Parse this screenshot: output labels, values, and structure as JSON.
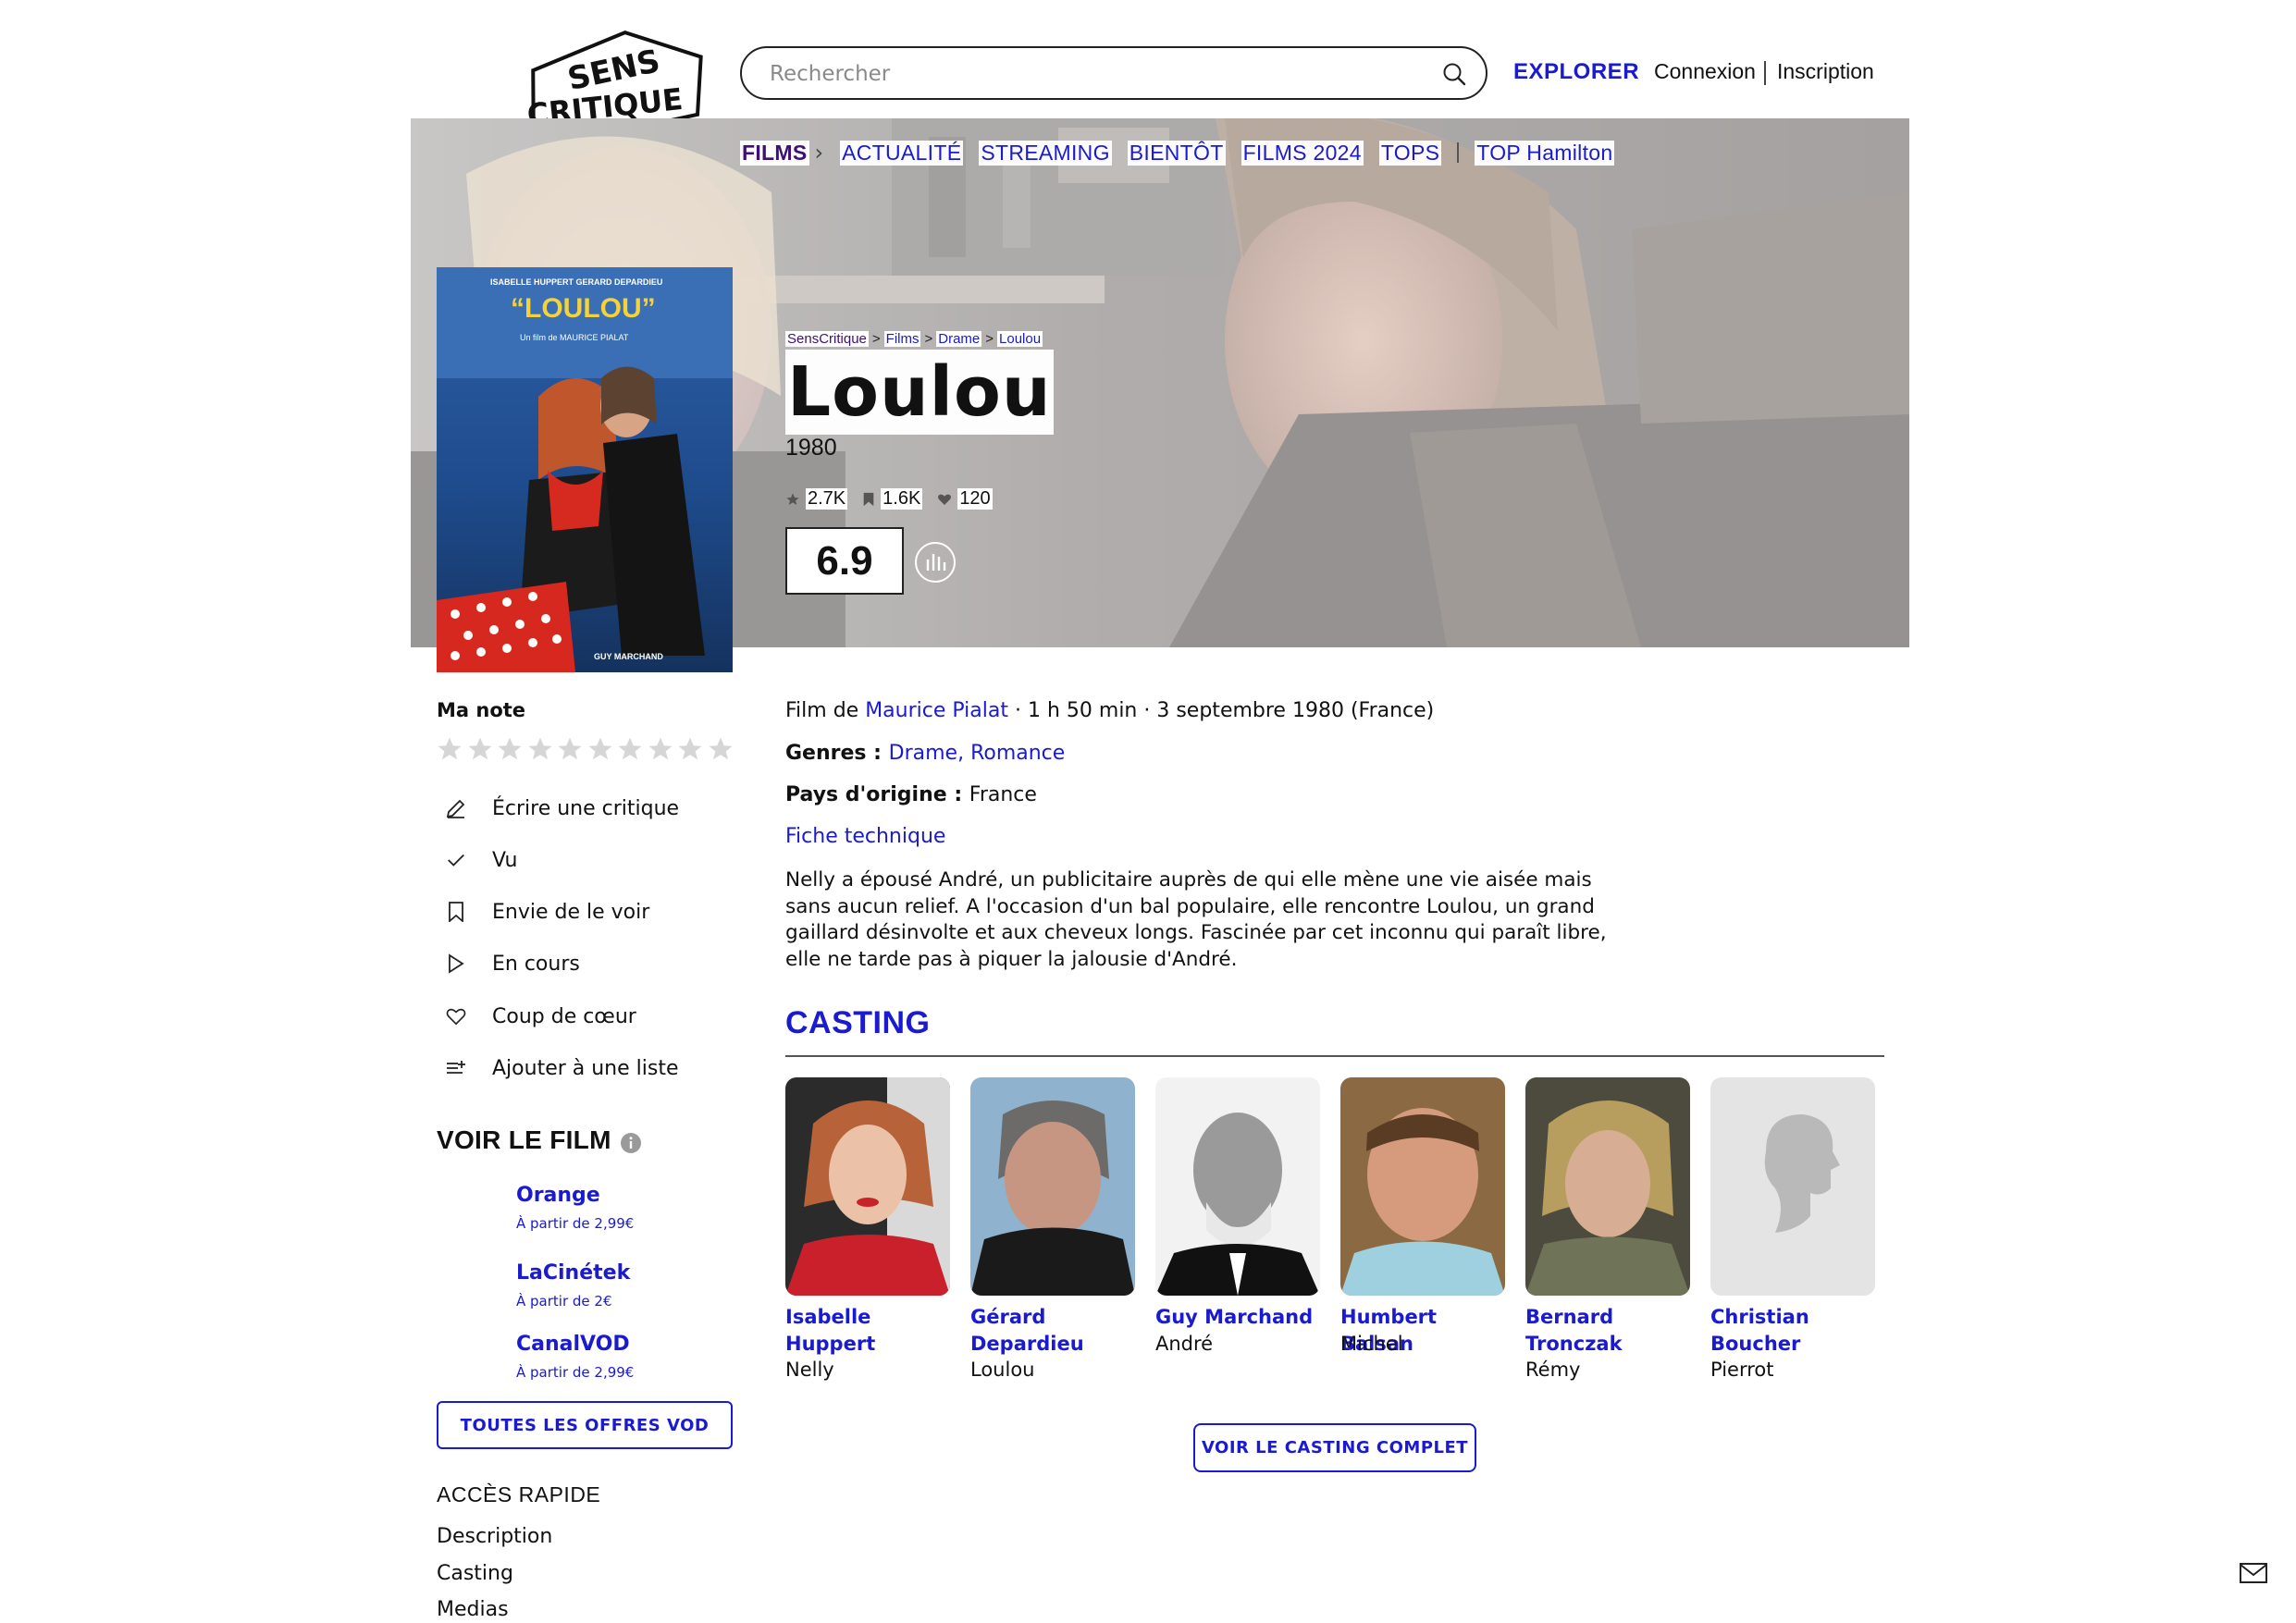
{
  "header": {
    "logo_line1": "SENS",
    "logo_line2": "CRITIQUE",
    "search_placeholder": "Rechercher",
    "explore_label": "EXPLORER",
    "login_label": "Connexion",
    "signup_label": "Inscription"
  },
  "nav": {
    "items": [
      "FILMS",
      "ACTUALITÉ",
      "STREAMING",
      "BIENTÔT",
      "FILMS 2024",
      "TOPS",
      "TOP Hamilton"
    ]
  },
  "poster": {
    "actors_line": "ISABELLE HUPPERT    GERARD DEPARDIEU",
    "title": "“LOULOU”",
    "director_line": "Un film de MAURICE PIALAT",
    "bottom_credit": "GUY MARCHAND"
  },
  "breadcrumb": [
    "SensCritique",
    "Films",
    "Drame",
    "Loulou"
  ],
  "breadcrumb_sep": ">",
  "movie": {
    "title": "Loulou",
    "year": "1980",
    "stats": {
      "ratings": "2.7K",
      "wishlist": "1.6K",
      "favorites": "120"
    },
    "score": "6.9",
    "director_prefix": "Film de ",
    "director": "Maurice Pialat",
    "meta_suffix": " · 1 h 50 min · 3 septembre 1980 (France)",
    "genres_label": "Genres : ",
    "genres": [
      "Drame",
      "Romance"
    ],
    "genre_sep": ", ",
    "country_label": "Pays d'origine : ",
    "country": "France",
    "tech_link": "Fiche technique",
    "synopsis": "Nelly a épousé André, un publicitaire auprès de qui elle mène une vie aisée mais sans aucun relief. A l'occasion d'un bal populaire, elle rencontre Loulou, un grand gaillard désinvolte et aux cheveux longs. Fascinée par cet inconnu qui paraît libre, elle ne tarde pas à piquer la jalousie d'André."
  },
  "user_rating": {
    "label": "Ma note",
    "max_stars": 10
  },
  "actions": [
    {
      "label": "Écrire une critique",
      "icon": "pencil-icon"
    },
    {
      "label": "Vu",
      "icon": "check-icon"
    },
    {
      "label": "Envie de le voir",
      "icon": "bookmark-icon"
    },
    {
      "label": "En cours",
      "icon": "play-icon"
    },
    {
      "label": "Coup de cœur",
      "icon": "heart-icon"
    },
    {
      "label": "Ajouter à une liste",
      "icon": "list-add-icon"
    }
  ],
  "watch": {
    "title": "VOIR LE FILM",
    "offers": [
      {
        "name": "Orange",
        "price": "À partir de 2,99€"
      },
      {
        "name": "LaCinétek",
        "price": "À partir de 2€"
      },
      {
        "name": "CanalVOD",
        "price": "À partir de 2,99€"
      }
    ],
    "all_offers_button": "TOUTES LES OFFRES VOD"
  },
  "quick_access": {
    "title": "ACCÈS RAPIDE",
    "links": [
      "Description",
      "Casting",
      "Medias"
    ]
  },
  "casting": {
    "title": "CASTING",
    "members": [
      {
        "name_line1": "Isabelle",
        "name_line2": "Huppert",
        "role": "Nelly"
      },
      {
        "name_line1": "Gérard",
        "name_line2": "Depardieu",
        "role": "Loulou"
      },
      {
        "name_line1": "Guy Marchand",
        "name_line2": "",
        "role": "André"
      },
      {
        "name_line1": "Humbert Balsan",
        "name_line2": "",
        "role": "Michel"
      },
      {
        "name_line1": "Bernard",
        "name_line2": "Tronczak",
        "role": "Rémy"
      },
      {
        "name_line1": "Christian",
        "name_line2": "Boucher",
        "role": "Pierrot"
      }
    ],
    "full_cast_button": "VOIR LE CASTING COMPLET"
  },
  "colors": {
    "accent": "#1a1ad0",
    "nav_active": "#3d1173",
    "text": "#111111"
  }
}
